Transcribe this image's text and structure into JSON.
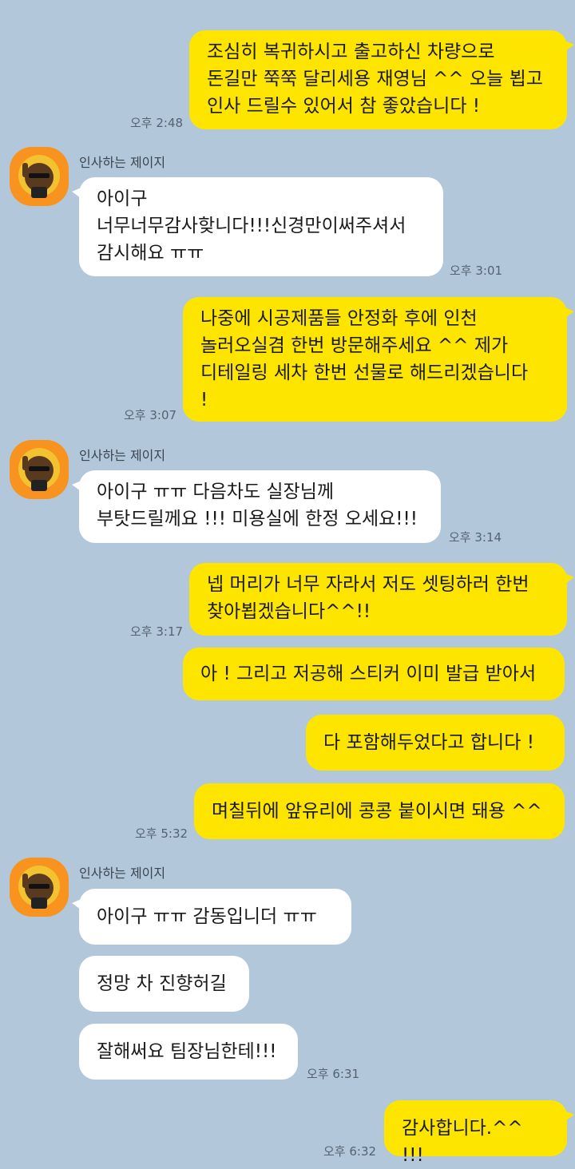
{
  "sender_name": "인사하는 제이지",
  "messages": [
    {
      "text": "조심히 복귀하시고 출고하신 차량으로\n돈길만 쭉쭉 달리세용 재영님 ^^ 오늘 뵙고\n인사 드릴수 있어서 참 좋았습니다 !",
      "time": "오후 2:48"
    },
    {
      "text": "아이구\n너무너무감사핮니다!!!신경만이써주셔서\n감시해요 ㅠㅠ",
      "time": "오후 3:01"
    },
    {
      "text": "나중에 시공제품들 안정화 후에 인천\n놀러오실겸 한번 방문해주세요 ^^ 제가\n디테일링 세차 한번 선물로 해드리겠습니다\n!",
      "time": "오후 3:07"
    },
    {
      "text": "아이구 ㅠㅠ 다음차도 실장님께\n부탓드릴께요 !!! 미용실에 한정 오세요!!!",
      "time": "오후 3:14"
    },
    {
      "text": "넵 머리가 너무 자라서 저도 셋팅하러 한번\n찾아뵙겠습니다^^!!",
      "time": "오후 3:17"
    },
    {
      "text": "아 ! 그리고 저공해 스티커 이미 발급 받아서"
    },
    {
      "text": "다 포함해두었다고 합니다 !"
    },
    {
      "text": "며칠뒤에 앞유리에 콩콩 붙이시면 돼용 ^^",
      "time": "오후 5:32"
    },
    {
      "text": "아이구 ㅠㅠ 감동입니더 ㅠㅠ"
    },
    {
      "text": "정망 차 진향허길"
    },
    {
      "text": "잘해써요 팀장님한테!!!",
      "time": "오후 6:31"
    },
    {
      "text": "감사합니다.^^  !!!",
      "time": "오후 6:32"
    }
  ],
  "colors": {
    "background": "#b2c7da",
    "sent_bubble": "#fee500",
    "received_bubble": "#ffffff",
    "avatar_bg": "#f7931e"
  }
}
